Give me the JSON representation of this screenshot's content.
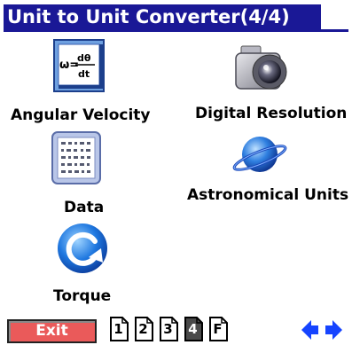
{
  "title": "Unit to Unit Converter(4/4)",
  "items": [
    {
      "label": "Angular Velocity",
      "formula": "ω=dθ/dt"
    },
    {
      "label": "Digital Resolution"
    },
    {
      "label": "Data"
    },
    {
      "label": "Astronomical Units"
    },
    {
      "label": "Torque"
    }
  ],
  "toolbar": {
    "exit_label": "Exit",
    "pages": [
      "1",
      "2",
      "3",
      "4",
      "F"
    ],
    "current_page": "4"
  },
  "colors": {
    "title_bg": "#1a1896",
    "exit_bg": "#ea5a5a",
    "arrow": "#1644ff"
  }
}
